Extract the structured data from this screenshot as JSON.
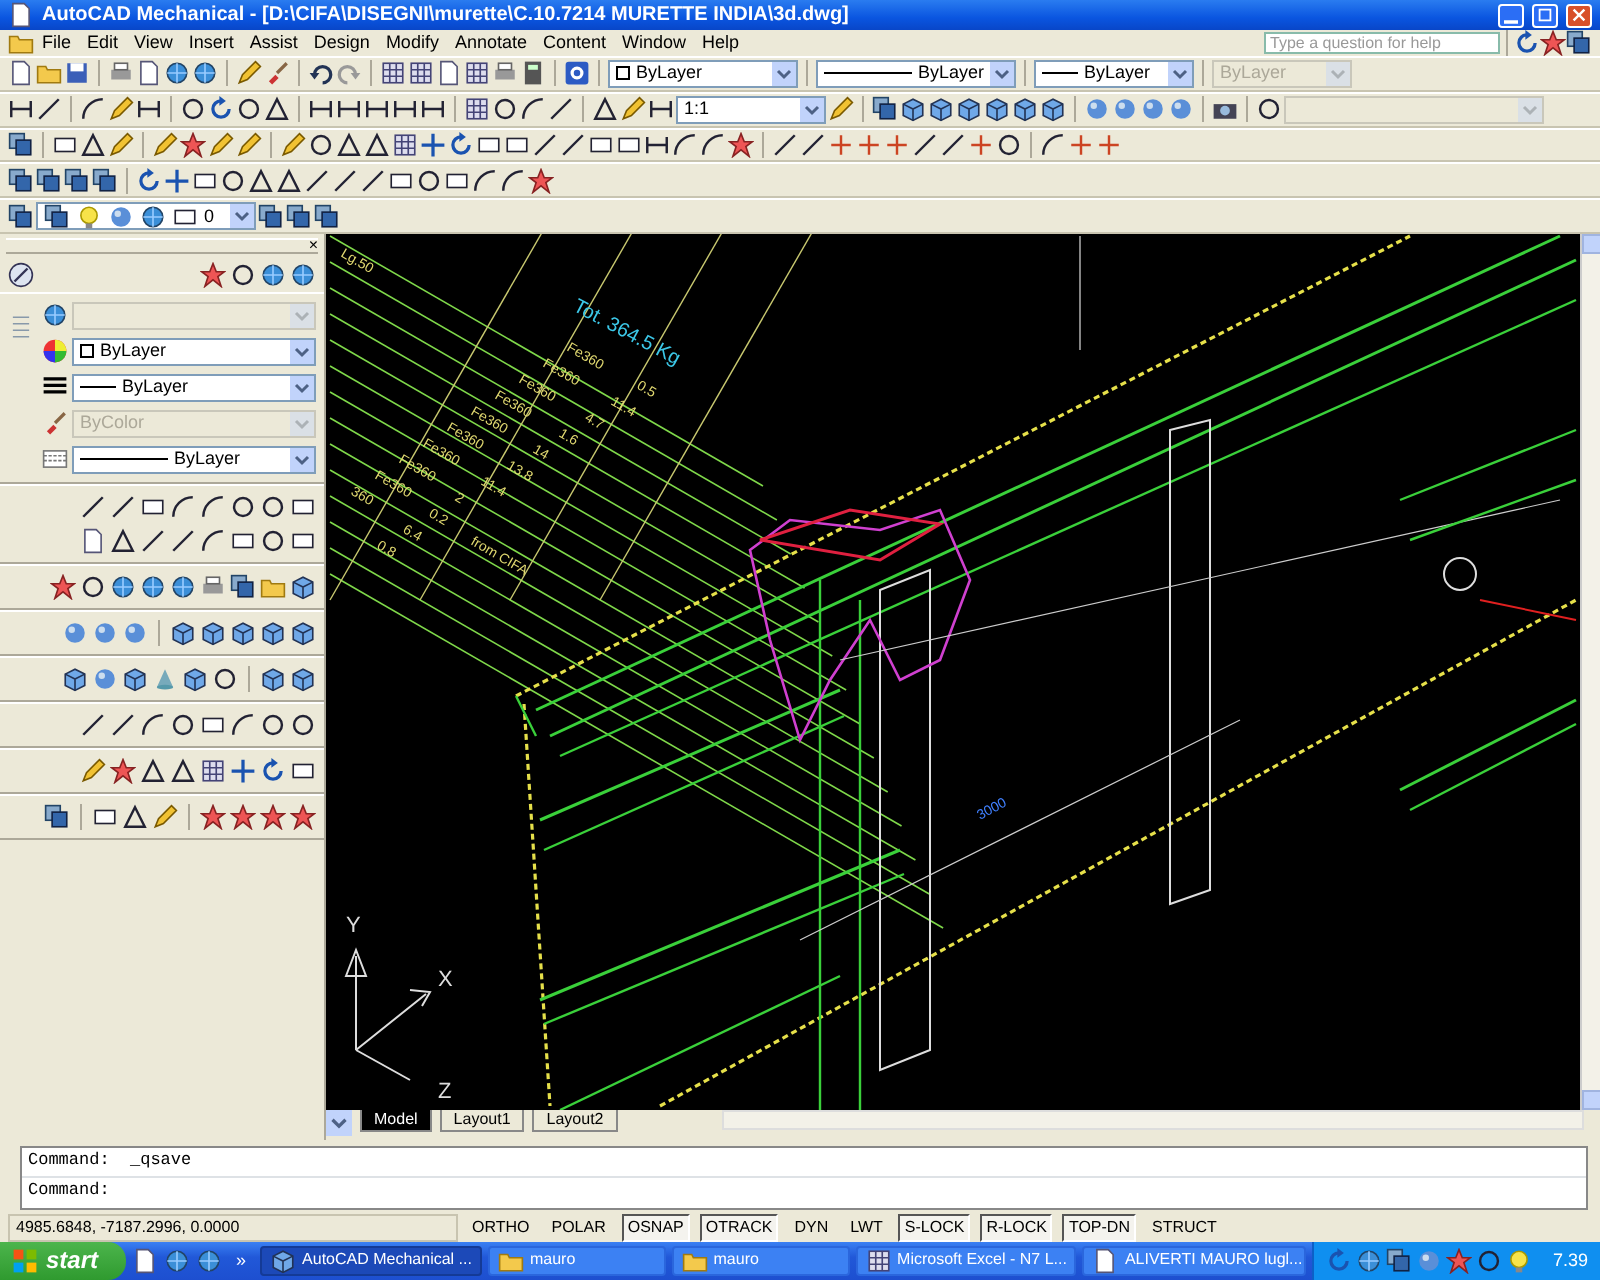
{
  "window": {
    "title": "AutoCAD Mechanical - [D:\\CIFA\\DISEGNI\\murette\\C.10.7214 MURETTE INDIA\\3d.dwg]"
  },
  "menu": [
    "File",
    "Edit",
    "View",
    "Insert",
    "Assist",
    "Design",
    "Modify",
    "Annotate",
    "Content",
    "Window",
    "Help"
  ],
  "help_search": {
    "placeholder": "Type a question for help"
  },
  "properties_toolbar": [
    {
      "kind": "color",
      "value": "ByLayer",
      "disabled": false
    },
    {
      "kind": "linetype",
      "value": "ByLayer",
      "disabled": false
    },
    {
      "kind": "lineweight",
      "value": "ByLayer",
      "disabled": false
    },
    {
      "kind": "plotstyle",
      "value": "ByLayer",
      "disabled": true
    }
  ],
  "scale_combo": {
    "value": "1:1"
  },
  "layer_combo": {
    "value": "0"
  },
  "left_panel": {
    "close_glyph": "×",
    "combos": [
      {
        "kind": "layer",
        "disabled": true
      },
      {
        "kind": "color",
        "value": "ByLayer",
        "disabled": false
      },
      {
        "kind": "lineweight",
        "value": "ByLayer",
        "disabled": false
      },
      {
        "kind": "plotstyle",
        "value": "ByColor",
        "disabled": true
      },
      {
        "kind": "linetype",
        "value": "ByLayer",
        "disabled": false
      }
    ]
  },
  "drawing": {
    "table_header": "Lg.50",
    "total": "Tot. 364.5 Kg",
    "materials": [
      "Fe360",
      "Fe360",
      "Fe360",
      "Fe360",
      "Fe360",
      "Fe360",
      "Fe360",
      "Fe360",
      "Fe360",
      "360"
    ],
    "values": [
      "0.5",
      "11.4",
      "4.7",
      "1.6",
      "14",
      "13.8",
      "11.4",
      "2",
      "0.2",
      "6.4",
      "0.8"
    ],
    "note": "from CIFA",
    "dimension": "3000",
    "axes": [
      "Y",
      "X",
      "Z"
    ]
  },
  "layout_tabs": [
    {
      "label": "Model",
      "selected": true
    },
    {
      "label": "Layout1",
      "selected": false
    },
    {
      "label": "Layout2",
      "selected": false
    }
  ],
  "command_lines": [
    "Command:  _qsave",
    "Command:"
  ],
  "status_bar": {
    "coordinates": "4985.6848, -7187.2996, 0.0000",
    "toggles": [
      {
        "label": "ORTHO",
        "on": false
      },
      {
        "label": "POLAR",
        "on": false
      },
      {
        "label": "OSNAP",
        "on": true
      },
      {
        "label": "OTRACK",
        "on": true
      },
      {
        "label": "DYN",
        "on": false
      },
      {
        "label": "LWT",
        "on": false
      },
      {
        "label": "S-LOCK",
        "on": true
      },
      {
        "label": "R-LOCK",
        "on": true
      },
      {
        "label": "TOP-DN",
        "on": true
      },
      {
        "label": "STRUCT",
        "on": false
      }
    ]
  },
  "taskbar": {
    "start": "start",
    "overflow": "»",
    "tasks": [
      {
        "label": "AutoCAD Mechanical ...",
        "selected": true
      },
      {
        "label": "mauro",
        "selected": false
      },
      {
        "label": "mauro",
        "selected": false
      },
      {
        "label": "Microsoft Excel - N7 L...",
        "selected": false
      },
      {
        "label": "ALIVERTI MAURO lugl...",
        "selected": false
      }
    ],
    "clock": "7.39"
  }
}
